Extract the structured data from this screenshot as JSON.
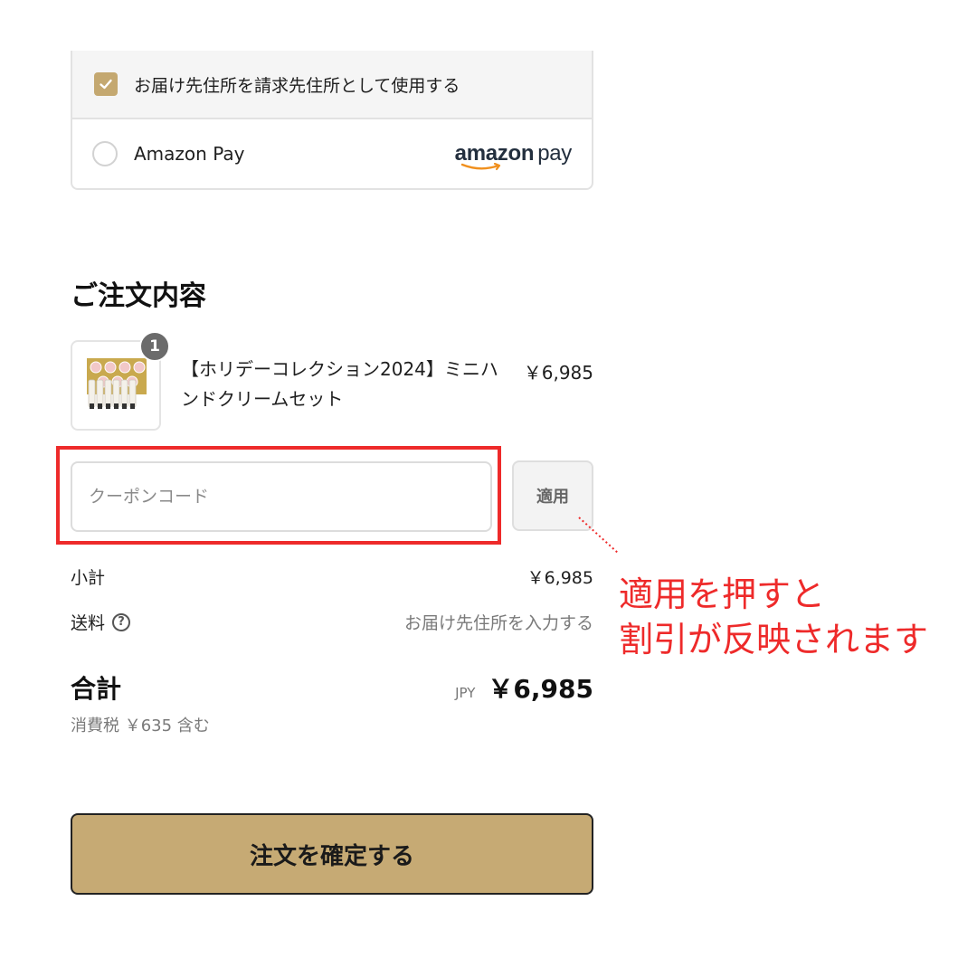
{
  "payment": {
    "billing_same_label": "お届け先住所を請求先住所として使用する",
    "billing_same_checked": true,
    "amazon_pay_label": "Amazon Pay",
    "amazon_pay_logo_text": "amazon pay",
    "amazon_pay_selected": false
  },
  "order": {
    "title": "ご注文内容",
    "item": {
      "quantity": "1",
      "name": "【ホリデーコレクション2024】ミニハンドクリームセット",
      "price": "￥6,985"
    }
  },
  "coupon": {
    "placeholder": "クーポンコード",
    "apply_label": "適用"
  },
  "annotation": {
    "line1": "適用を押すと",
    "line2": "割引が反映されます",
    "color": "#ee2a2a"
  },
  "summary": {
    "subtotal_label": "小計",
    "subtotal_value": "￥6,985",
    "shipping_label": "送料",
    "shipping_value": "お届け先住所を入力する",
    "total_label": "合計",
    "currency": "JPY",
    "total_value": "￥6,985",
    "tax_note": "消費税 ￥635 含む"
  },
  "confirm_button_label": "注文を確定する",
  "colors": {
    "accent_gold": "#c6aa74",
    "highlight_red": "#ee2a2a"
  }
}
